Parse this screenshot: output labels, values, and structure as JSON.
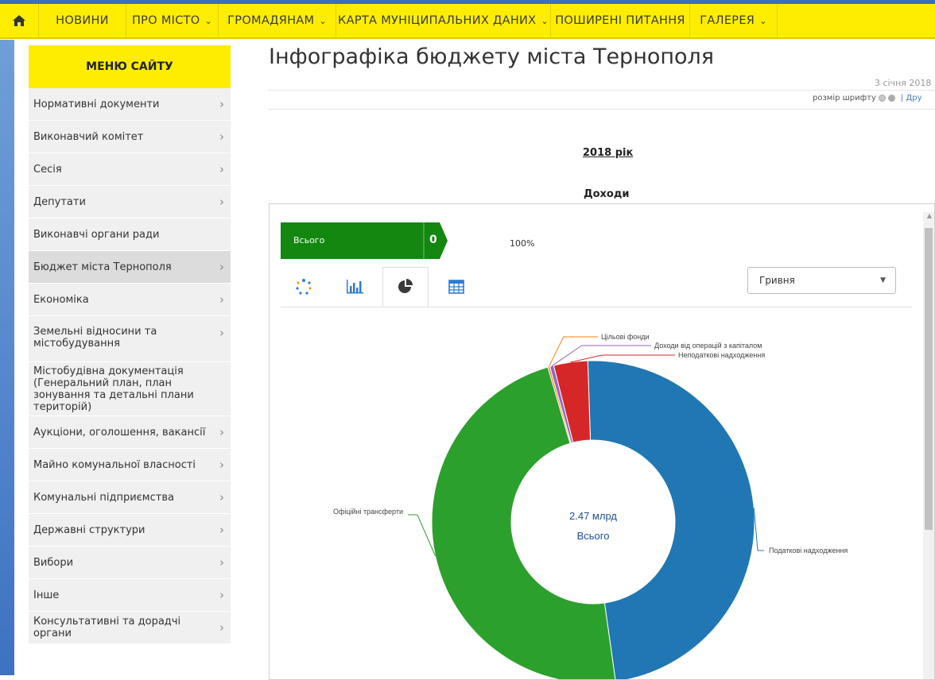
{
  "nav": {
    "items": [
      {
        "label": "НОВИНИ",
        "dropdown": false
      },
      {
        "label": "ПРО МІСТО",
        "dropdown": true
      },
      {
        "label": "ГРОМАДЯНАМ",
        "dropdown": true
      },
      {
        "label": "КАРТА МУНІЦИПАЛЬНИХ ДАНИХ",
        "dropdown": true
      },
      {
        "label": "ПОШИРЕНІ ПИТАННЯ",
        "dropdown": false
      },
      {
        "label": "ГАЛЕРЕЯ",
        "dropdown": true
      }
    ]
  },
  "sidebar": {
    "title": "МЕНЮ САЙТУ",
    "items": [
      {
        "label": "Нормативні документи",
        "arrow": true,
        "active": false
      },
      {
        "label": "Виконавчий комітет",
        "arrow": true,
        "active": false
      },
      {
        "label": "Сесія",
        "arrow": true,
        "active": false
      },
      {
        "label": "Депутати",
        "arrow": true,
        "active": false
      },
      {
        "label": "Виконавчі органи ради",
        "arrow": false,
        "active": false
      },
      {
        "label": "Бюджет міста Тернополя",
        "arrow": true,
        "active": true
      },
      {
        "label": "Економіка",
        "arrow": true,
        "active": false
      },
      {
        "label": "Земельні відносини та містобудування",
        "arrow": true,
        "active": false
      },
      {
        "label": "Містобудівна документація (Генеральний план, план зонування та детальні плани територій)",
        "arrow": false,
        "active": false
      },
      {
        "label": "Аукціони, оголошення, вакансії",
        "arrow": true,
        "active": false
      },
      {
        "label": "Майно комунальної власності",
        "arrow": true,
        "active": false
      },
      {
        "label": "Комунальні підприємства",
        "arrow": true,
        "active": false
      },
      {
        "label": "Державні структури",
        "arrow": true,
        "active": false
      },
      {
        "label": "Вибори",
        "arrow": true,
        "active": false
      },
      {
        "label": "Інше",
        "arrow": true,
        "active": false
      },
      {
        "label": "Консультативні та дорадчі органи",
        "arrow": true,
        "active": false
      }
    ]
  },
  "page": {
    "title": "Інфографіка бюджету міста Тернополя",
    "date": "3 січня 2018",
    "font_size_label": "розмір шрифту",
    "print_label": "| Дру",
    "year_label": "2018 рік",
    "section_label": "Доходи"
  },
  "widget": {
    "total_label": "Всього",
    "total_value": "0",
    "total_percent": "100%",
    "currency": "Гривня",
    "tabs": [
      {
        "icon": "bubbles-icon",
        "active": false
      },
      {
        "icon": "bar-chart-icon",
        "active": false
      },
      {
        "icon": "pie-chart-icon",
        "active": true
      },
      {
        "icon": "table-icon",
        "active": false
      }
    ]
  },
  "chart_data": {
    "type": "pie",
    "center_value": "2.47 млрд",
    "center_label": "Всього",
    "slices": [
      {
        "name": "Податкові надходження",
        "share": 0.483,
        "color": "#2077b4"
      },
      {
        "name": "Офіційні трансферти",
        "share": 0.477,
        "color": "#2ca02c"
      },
      {
        "name": "Неподаткові надходження",
        "share": 0.034,
        "color": "#d62728"
      },
      {
        "name": "Доходи від операцій з капіталом",
        "share": 0.004,
        "color": "#9467bd"
      },
      {
        "name": "Цільові фонди",
        "share": 0.002,
        "color": "#ff7f0e"
      }
    ]
  }
}
